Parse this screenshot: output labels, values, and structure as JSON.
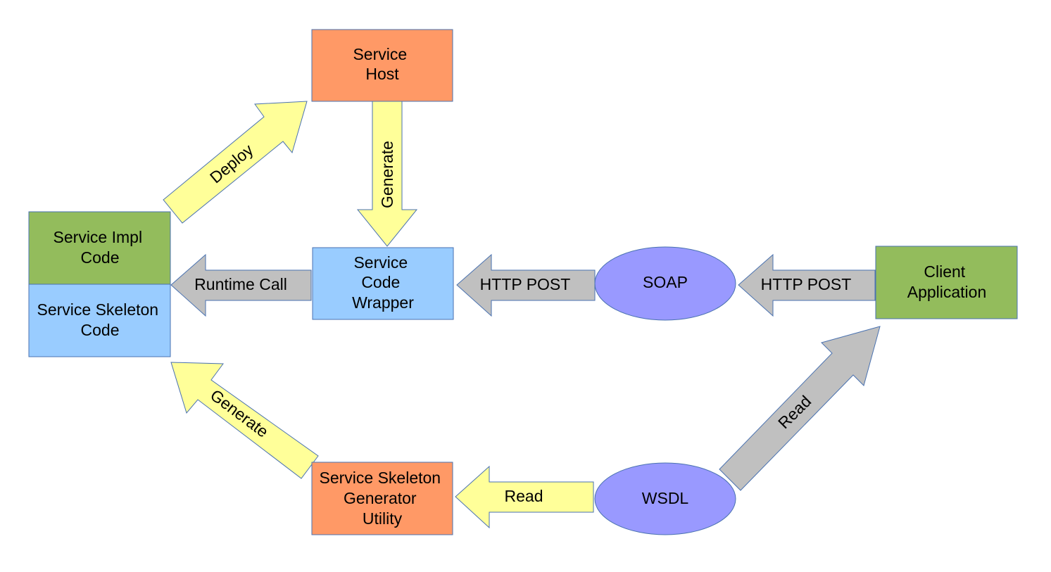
{
  "colors": {
    "orange": "#ff9966",
    "green": "#93bc5c",
    "blue": "#99ccff",
    "purple": "#9999ff",
    "yellow": "#ffff99",
    "gray": "#c0c0c0",
    "stroke": "#4a72b0"
  },
  "nodes": {
    "service_host": [
      "Service",
      "Host"
    ],
    "service_impl": [
      "Service Impl",
      "Code"
    ],
    "service_skeleton": [
      "Service Skeleton",
      "Code"
    ],
    "service_wrapper": [
      "Service",
      "Code",
      "Wrapper"
    ],
    "soap": "SOAP",
    "client_app": [
      "Client",
      "Application"
    ],
    "wsdl": "WSDL",
    "skeleton_generator": [
      "Service Skeleton",
      "Generator",
      "Utility"
    ]
  },
  "arrows": {
    "deploy": "Deploy",
    "generate_wrapper": "Generate",
    "runtime_call": "Runtime Call",
    "http_post_1": "HTTP POST",
    "http_post_2": "HTTP POST",
    "read_client": "Read",
    "read_wsdl": "Read",
    "generate_skeleton": "Generate"
  }
}
